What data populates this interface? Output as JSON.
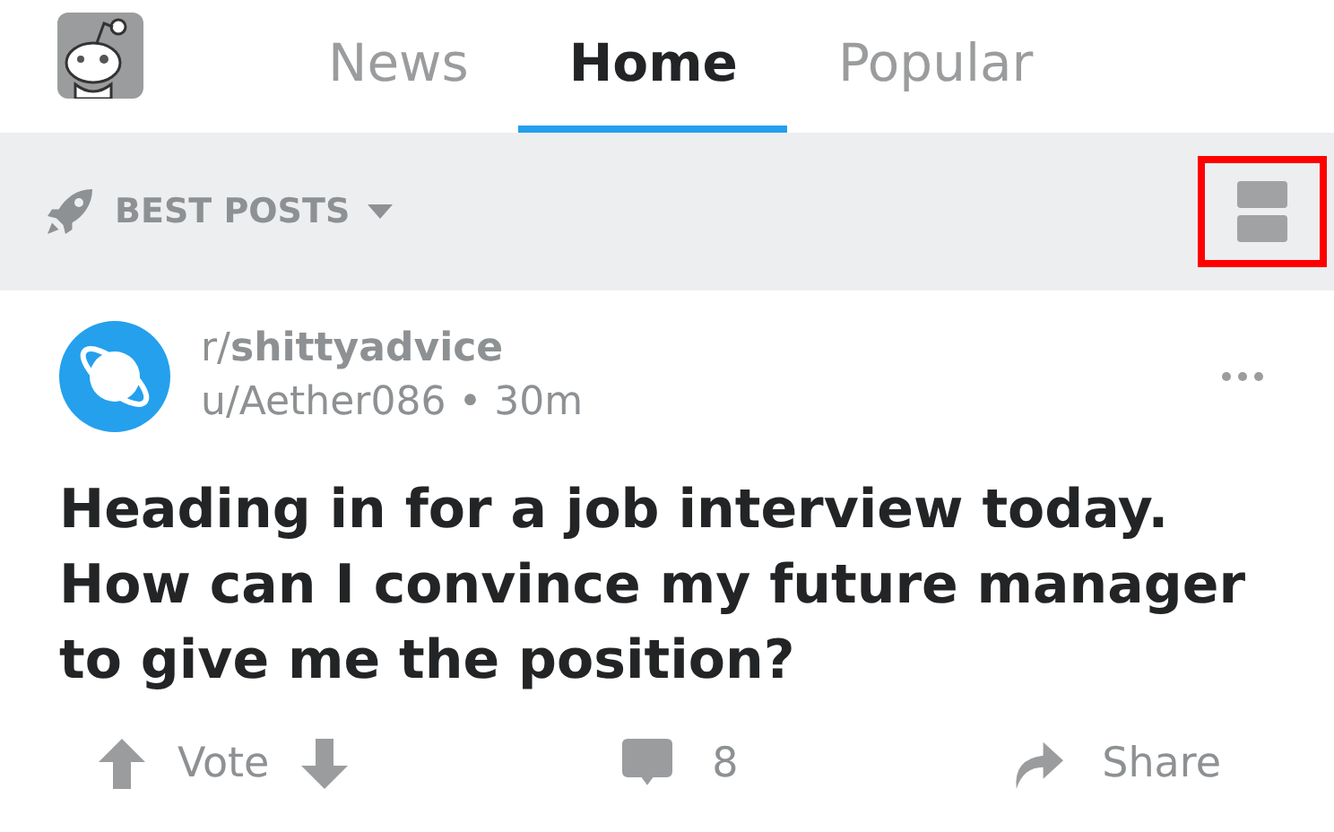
{
  "tabs": [
    {
      "label": "News",
      "selected": false
    },
    {
      "label": "Home",
      "selected": true
    },
    {
      "label": "Popular",
      "selected": false
    }
  ],
  "sort": {
    "label": "BEST POSTS"
  },
  "view_button": {
    "highlighted": true
  },
  "post": {
    "subreddit": "r/**shittyadvice**",
    "byline": "u/Aether086 • 30m",
    "title": "Heading in for a job interview today. How can I convince my future manager to give me the position?",
    "vote_label": "Vote",
    "comments": "8",
    "share_label": "Share"
  }
}
